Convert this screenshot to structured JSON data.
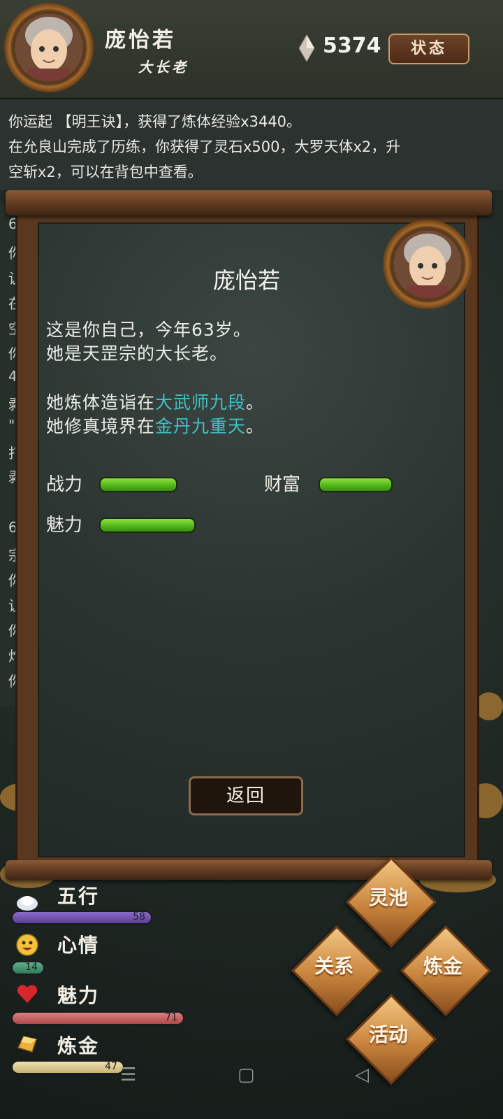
{
  "header": {
    "name": "庞怡若",
    "title": "大长老",
    "gem_count": "5374",
    "status_button": "状态"
  },
  "log": {
    "lines": [
      "你运起 【明王诀】，获得了炼体经验x3440。",
      "在允良山完成了历练，你获得了灵石x500，大罗天体x2，升",
      "空斩x2，可以在背包中查看。"
    ],
    "left_chars": [
      "6",
      "你",
      "让",
      "在",
      "空",
      "你",
      "4",
      "剥",
      "\"",
      "打",
      "剥",
      "6",
      "宗",
      "你",
      "让",
      "你",
      "炸",
      "你"
    ]
  },
  "modal": {
    "name": "庞怡若",
    "line1": "这是你自己，今年63岁。",
    "line2": "她是天罡宗的大长老。",
    "line3_prefix": "她炼体造诣在",
    "line3_highlight": "大武师九段",
    "line3_suffix": "。",
    "line4_prefix": "她修真境界在",
    "line4_highlight": "金丹九重天",
    "line4_suffix": "。",
    "stats": {
      "combat_label": "战力",
      "wealth_label": "财富",
      "charm_label": "魅力"
    },
    "back_button": "返回"
  },
  "bottom_stats": [
    {
      "label": "五行",
      "value": "58",
      "color": "#6a4ba8"
    },
    {
      "label": "心情",
      "value": "14",
      "color": "#3e8c6b"
    },
    {
      "label": "魅力",
      "value": "71",
      "color": "#c45a5a"
    },
    {
      "label": "炼金",
      "value": "47",
      "color": "#d9c78f"
    }
  ],
  "actions": {
    "lingchi": "灵池",
    "guanxi": "关系",
    "lianjin": "炼金",
    "huodong": "活动"
  },
  "nav": {
    "menu_icon": "menu-icon",
    "home_icon": "home-icon",
    "back_icon": "back-icon"
  }
}
